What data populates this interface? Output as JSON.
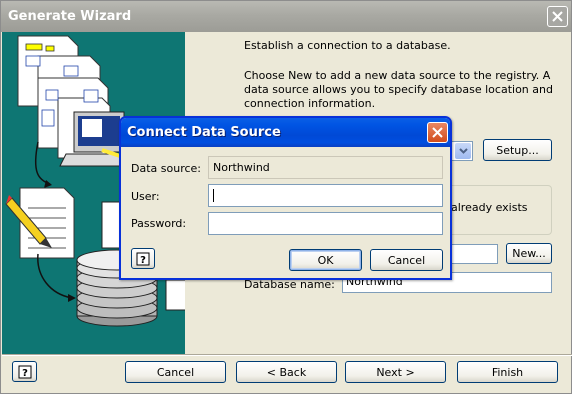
{
  "wizard": {
    "title": "Generate Wizard",
    "intro": "Establish a connection to a database.",
    "description": "Choose New to add a new data source to the registry. A data source allows you to specify database location and connection information.",
    "setup_label": "Setup...",
    "exists_partial": "already exists",
    "new_label": "New...",
    "database_name_label": "Database name:",
    "database_name_value": "Northwind",
    "buttons": {
      "cancel": "Cancel",
      "back": "< Back",
      "next": "Next >",
      "finish": "Finish"
    }
  },
  "dialog": {
    "title": "Connect Data Source",
    "data_source_label": "Data source:",
    "data_source_value": "Northwind",
    "user_label": "User:",
    "user_value": "",
    "password_label": "Password:",
    "password_value": "",
    "ok_label": "OK",
    "cancel_label": "Cancel"
  },
  "icons": {
    "help": "help-icon",
    "close": "close-icon",
    "dropdown": "chevron-down-icon"
  }
}
